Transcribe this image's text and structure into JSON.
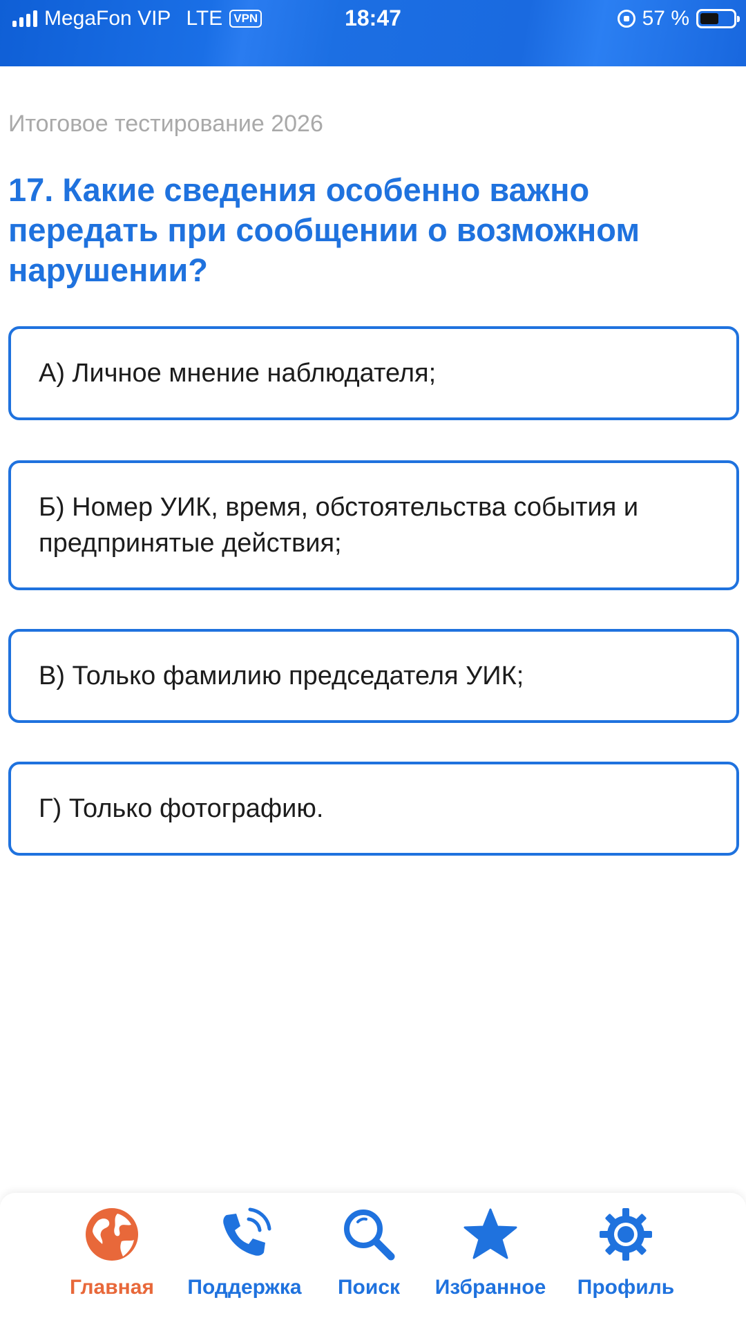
{
  "status_bar": {
    "carrier": "MegaFon VIP",
    "network": "LTE",
    "vpn": "VPN",
    "time": "18:47",
    "battery_text": "57 %",
    "battery_level": 0.57
  },
  "quiz": {
    "subtitle": "Итоговое тестирование 2026",
    "question": "17. Какие сведения особенно важно передать при сообщении о возможном нарушении?",
    "options": [
      "А) Личное мнение наблюдателя;",
      "Б) Номер УИК, время, обстоятельства события и предпринятые действия;",
      "В) Только фамилию председателя УИК;",
      "Г) Только фотографию."
    ]
  },
  "nav": {
    "items": [
      {
        "label": "Главная",
        "icon": "globe-icon",
        "active": true
      },
      {
        "label": "Поддержка",
        "icon": "phone-icon",
        "active": false
      },
      {
        "label": "Поиск",
        "icon": "search-icon",
        "active": false
      },
      {
        "label": "Избранное",
        "icon": "star-icon",
        "active": false
      },
      {
        "label": "Профиль",
        "icon": "gear-icon",
        "active": false
      }
    ]
  },
  "colors": {
    "accent": "#1f72de",
    "active_nav": "#e8683a",
    "subtitle": "#a9a9a9"
  }
}
